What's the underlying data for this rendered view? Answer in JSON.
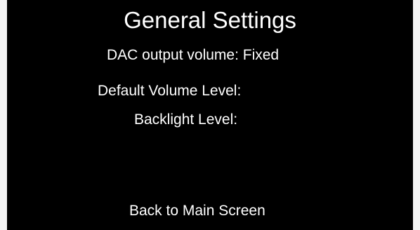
{
  "screen": {
    "title": "General Settings",
    "dac_output_volume": "DAC output volume: Fixed",
    "default_volume_level": "Default Volume Level:",
    "backlight_level": "Backlight Level:",
    "back_button_label": "Back to Main Screen"
  },
  "colors": {
    "background": "#000000",
    "text": "#ffffff",
    "frame": "#f4f4f4"
  }
}
